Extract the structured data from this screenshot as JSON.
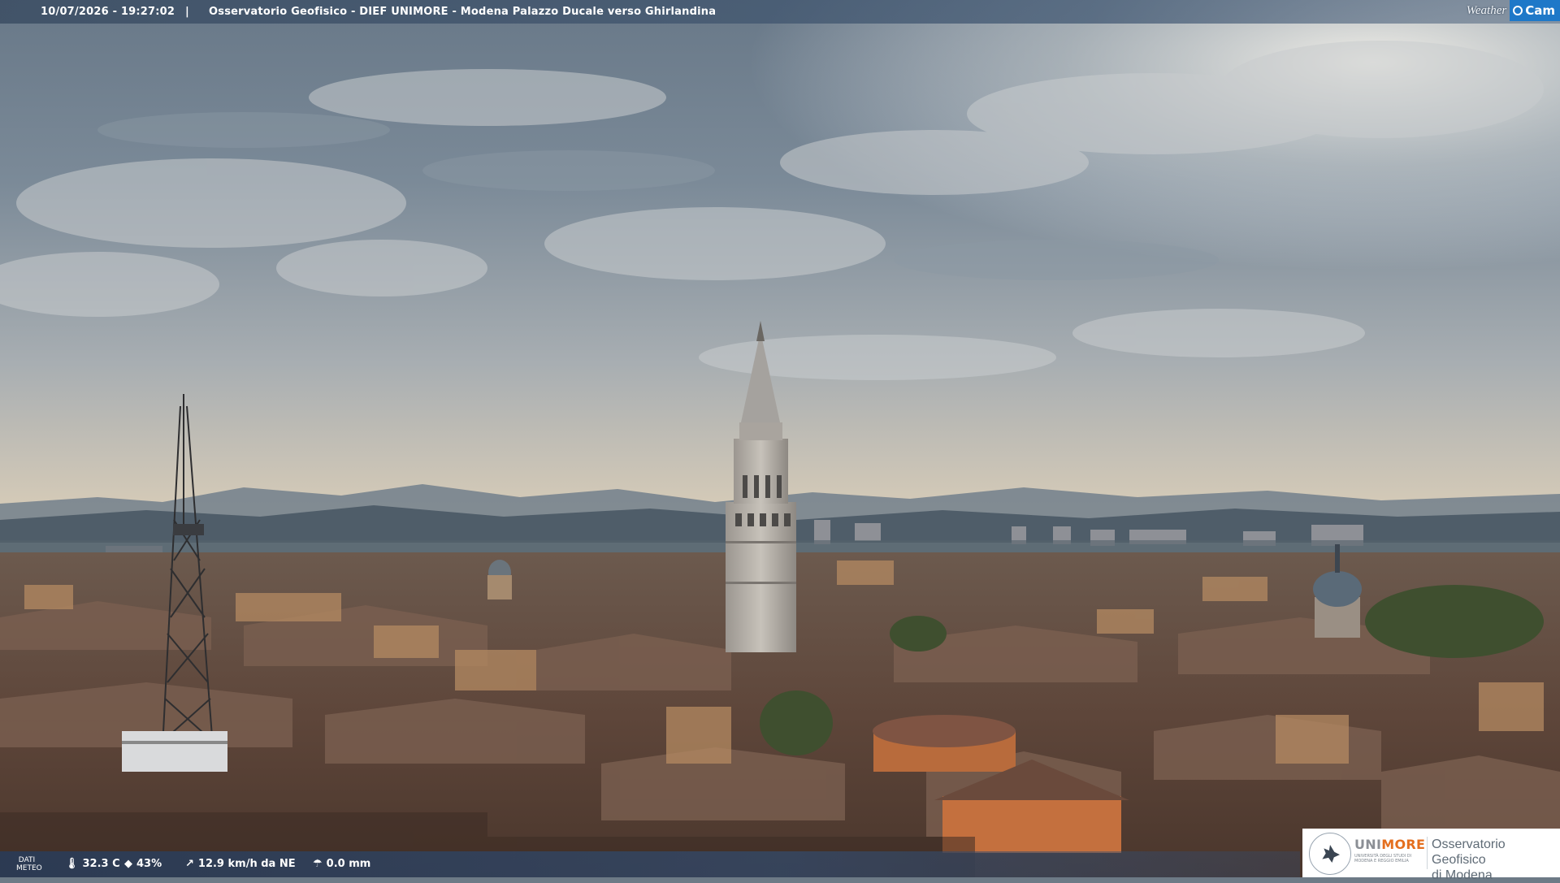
{
  "header": {
    "timestamp": "10/07/2026 - 19:27:02",
    "separator": "|",
    "title": "Osservatorio Geofisico - DIEF UNIMORE - Modena Palazzo Ducale verso Ghirlandina"
  },
  "brand": {
    "weather": "Weather",
    "cam": "Cam"
  },
  "weather_data": {
    "label": "DATI METEO",
    "temperature": "32.3 C",
    "humidity": "43%",
    "wind": "12.9 km/h da NE",
    "rain": "0.0 mm"
  },
  "logo": {
    "uni_part1": "UNI",
    "uni_part2": "MORE",
    "university_sub": "UNIVERSITÀ DEGLI STUDI DI MODENA E REGGIO EMILIA",
    "observatory_line1": "Osservatorio Geofisico",
    "observatory_line2": "di Modena"
  },
  "icons": [
    "thermometer-icon",
    "humidity-drop-icon",
    "wind-icon",
    "rain-gauge-icon"
  ],
  "colors": {
    "accent_blue": "#1e78c8",
    "unimore_orange": "#e46f1f"
  }
}
